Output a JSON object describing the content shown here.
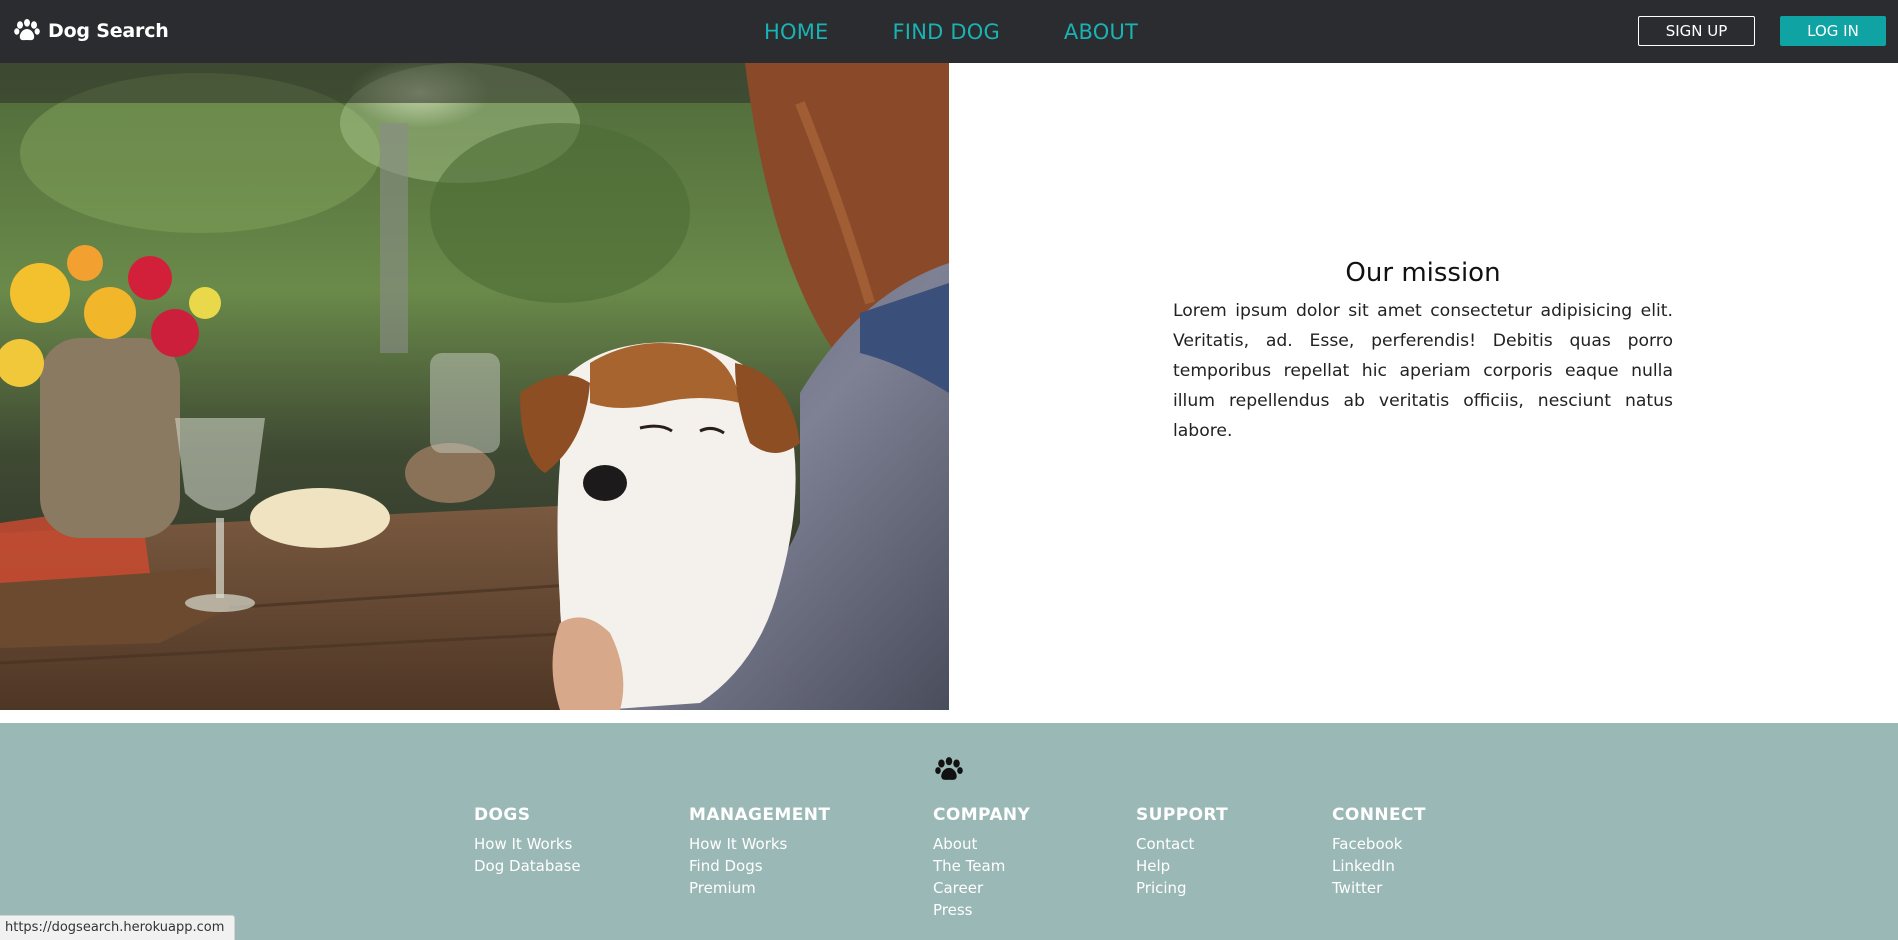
{
  "header": {
    "brand_name": "Dog Search",
    "brand_icon": "paw-icon",
    "nav": {
      "home": "HOME",
      "find_dog": "FIND DOG",
      "about": "ABOUT"
    },
    "signup_label": "SIGN UP",
    "login_label": "LOG IN"
  },
  "hero": {
    "image_subject": "dog-hugging-owner-photo"
  },
  "mission": {
    "title": "Our mission",
    "text": "Lorem ipsum dolor sit amet consectetur adipisicing elit. Veritatis, ad. Esse, perferendis! Debitis quas porro temporibus repellat hic aperiam corporis eaque nulla illum repellendus ab veritatis officiis, nesciunt natus labore."
  },
  "footer": {
    "icon": "paw-icon",
    "columns": [
      {
        "heading": "DOGS",
        "links": [
          "How It Works",
          "Dog Database"
        ]
      },
      {
        "heading": "MANAGEMENT",
        "links": [
          "How It Works",
          "Find Dogs",
          "Premium"
        ]
      },
      {
        "heading": "COMPANY",
        "links": [
          "About",
          "The Team",
          "Career",
          "Press"
        ]
      },
      {
        "heading": "SUPPORT",
        "links": [
          "Contact",
          "Help",
          "Pricing"
        ]
      },
      {
        "heading": "CONNECT",
        "links": [
          "Facebook",
          "LinkedIn",
          "Twitter"
        ]
      }
    ]
  },
  "status_bar": {
    "url": "https://dogsearch.herokuapp.com"
  },
  "colors": {
    "navbar_bg": "#2b2c30",
    "nav_accent": "#19b3b3",
    "login_bg": "#0fa3a3",
    "footer_bg": "#9ab8b5"
  }
}
